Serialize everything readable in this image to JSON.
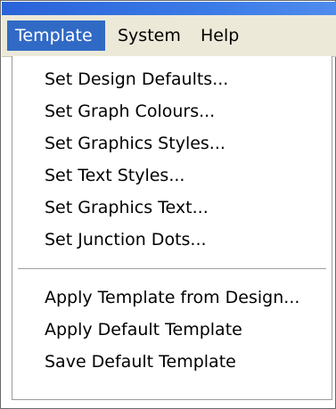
{
  "menubar": {
    "items": [
      {
        "label": "Template",
        "active": true
      },
      {
        "label": "System",
        "active": false
      },
      {
        "label": "Help",
        "active": false
      }
    ]
  },
  "template_menu": {
    "group1": [
      "Set Design Defaults...",
      "Set Graph Colours...",
      "Set Graphics Styles...",
      "Set Text Styles...",
      "Set Graphics Text...",
      "Set Junction Dots..."
    ],
    "group2": [
      "Apply Template from Design...",
      "Apply Default Template",
      "Save Default Template"
    ]
  },
  "colors": {
    "title_strip": "#2a63d8",
    "menubar_bg": "#ece9d8",
    "selection": "#316ac5",
    "menu_bg": "#ffffff"
  }
}
